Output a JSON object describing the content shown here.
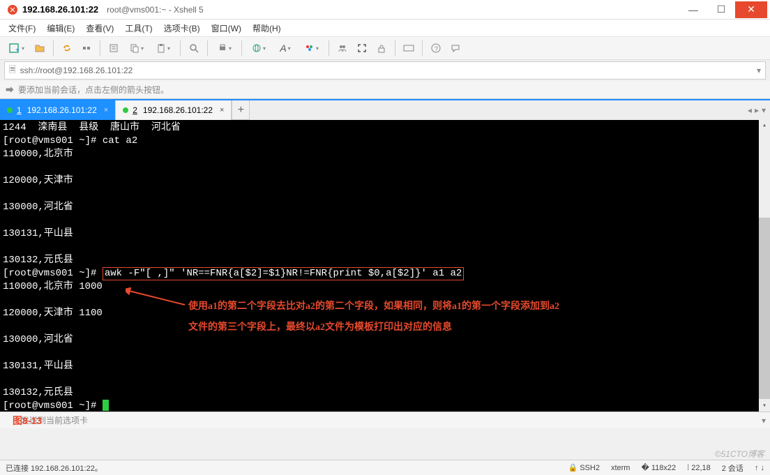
{
  "title": {
    "ip": "192.168.26.101:22",
    "rest": "root@vms001:~ - Xshell 5"
  },
  "menu": {
    "file": "文件(F)",
    "edit": "编辑(E)",
    "view": "查看(V)",
    "tools": "工具(T)",
    "tabs": "选项卡(B)",
    "window": "窗口(W)",
    "help": "帮助(H)"
  },
  "address": {
    "url": "ssh://root@192.168.26.101:22"
  },
  "hint": {
    "text": "要添加当前会话，点击左侧的箭头按钮。"
  },
  "tabs": {
    "items": [
      {
        "num": "1",
        "label": "192.168.26.101:22",
        "active": true
      },
      {
        "num": "2",
        "label": "192.168.26.101:22",
        "active": false
      }
    ],
    "add": "+"
  },
  "terminal": {
    "lines": [
      "1244  滦南县  县级  唐山市  河北省",
      "[root@vms001 ~]# cat a2",
      "110000,北京市",
      "",
      "120000,天津市",
      "",
      "130000,河北省",
      "",
      "130131,平山县",
      "",
      "130132,元氏县"
    ],
    "prompt": "[root@vms001 ~]# ",
    "hl_cmd": "awk -F\"[ ,]\" 'NR==FNR{a[$2]=$1}NR!=FNR{print $0,a[$2]}' a1 a2",
    "out": [
      "110000,北京市 1000",
      "",
      "120000,天津市 1100",
      "",
      "130000,河北省",
      "",
      "130131,平山县",
      "",
      "130132,元氏县"
    ],
    "prompt2": "[root@vms001 ~]# ",
    "ann1": "使用a1的第二个字段去比对a2的第二个字段，如果相同，则将a1的第一个字段添加到a2",
    "ann2": "文件的第三个字段上，最终以a2文件为模板打印出对应的信息"
  },
  "compose": {
    "fig": "图8-13",
    "ghost": "发送到当前选项卡"
  },
  "status": {
    "left": "已连接 192.168.26.101:22。",
    "ssh": "SSH2",
    "term": "xterm",
    "size": "118x22",
    "pos": "22,18",
    "sess": "2 会话",
    "net": "↑  ↓"
  },
  "watermark": "©51CTO博客"
}
